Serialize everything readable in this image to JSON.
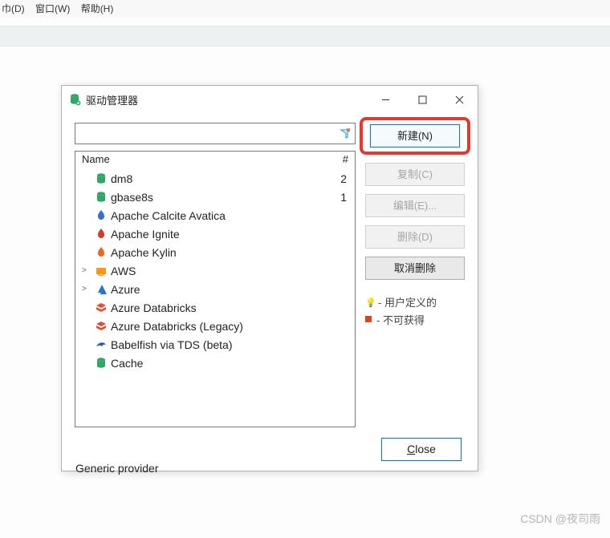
{
  "menubar": {
    "file": "⼱(D)",
    "window": "窗口(W)",
    "help": "帮助(H)"
  },
  "dialog": {
    "title": "驱动管理器",
    "filter_placeholder": "",
    "header_name": "Name",
    "header_count": "#",
    "drivers": [
      {
        "label": "dm8",
        "count": "2",
        "icon": "db-green",
        "expander": ""
      },
      {
        "label": "gbase8s",
        "count": "1",
        "icon": "db-green",
        "expander": ""
      },
      {
        "label": "Apache Calcite Avatica",
        "count": "",
        "icon": "flame-blue",
        "expander": ""
      },
      {
        "label": "Apache Ignite",
        "count": "",
        "icon": "flame-red",
        "expander": ""
      },
      {
        "label": "Apache Kylin",
        "count": "",
        "icon": "flame-orange",
        "expander": ""
      },
      {
        "label": "AWS",
        "count": "",
        "icon": "aws",
        "expander": ">"
      },
      {
        "label": "Azure",
        "count": "",
        "icon": "azure",
        "expander": ">"
      },
      {
        "label": "Azure Databricks",
        "count": "",
        "icon": "databricks",
        "expander": ""
      },
      {
        "label": "Azure Databricks (Legacy)",
        "count": "",
        "icon": "databricks",
        "expander": ""
      },
      {
        "label": "Babelfish via TDS (beta)",
        "count": "",
        "icon": "dolphin",
        "expander": ""
      },
      {
        "label": "Cache",
        "count": "",
        "icon": "db-green",
        "expander": ""
      }
    ],
    "buttons": {
      "new_": "新建(N)",
      "copy": "复制(C)",
      "edit": "编辑(E)...",
      "delete_": "删除(D)",
      "undelete": "取消删除"
    },
    "legend": {
      "user_defined": "- 用户定义的",
      "unavailable": "- 不可获得"
    },
    "close": "Close"
  },
  "sub_label": "Generic provider",
  "watermark": "CSDN @夜司雨"
}
